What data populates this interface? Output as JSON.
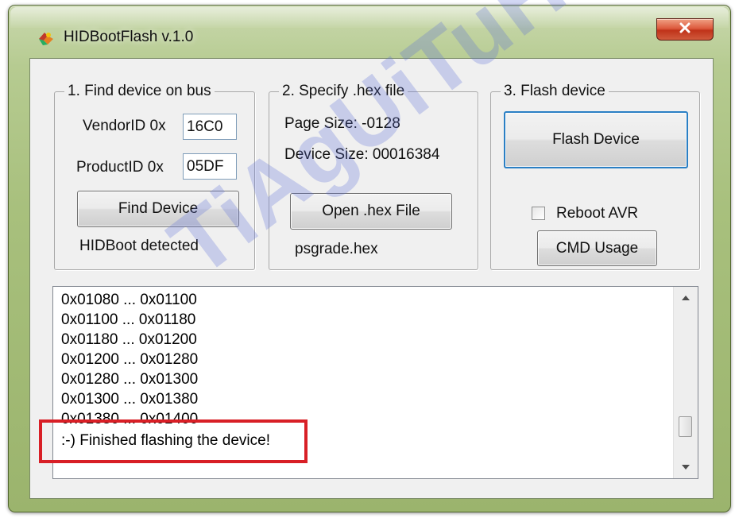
{
  "window": {
    "title": "HIDBootFlash v.1.0"
  },
  "find_group": {
    "legend": "1. Find device on bus",
    "vendor_label": "VendorID 0x",
    "vendor_value": "16C0",
    "product_label": "ProductID 0x",
    "product_value": "05DF",
    "find_button": "Find Device",
    "status": "HIDBoot detected"
  },
  "hex_group": {
    "legend": "2. Specify .hex file",
    "page_size": "Page Size: -0128",
    "device_size": "Device Size: 00016384",
    "open_button": "Open .hex File",
    "file_name": "psgrade.hex"
  },
  "flash_group": {
    "legend": "3. Flash device",
    "flash_button": "Flash Device",
    "reboot_label": "Reboot AVR",
    "reboot_checked": false,
    "cmd_button": "CMD Usage"
  },
  "log": {
    "lines": [
      "0x01080 ... 0x01100",
      "0x01100 ... 0x01180",
      "0x01180 ... 0x01200",
      "0x01200 ... 0x01280",
      "0x01280 ... 0x01300",
      "0x01300 ... 0x01380",
      "0x01380 ... 0x01400"
    ],
    "final": ":-) Finished flashing the device!"
  },
  "watermark": "TiAgUiTuH",
  "colors": {
    "highlight": "#d81f26",
    "watermark": "#5f6ed7",
    "default_button_border": "#2a7fc4"
  },
  "icons": {
    "app": "app-logo-icon",
    "close": "close-x-icon",
    "scroll_up": "scroll-up-arrow-icon",
    "scroll_down": "scroll-down-arrow-icon"
  }
}
